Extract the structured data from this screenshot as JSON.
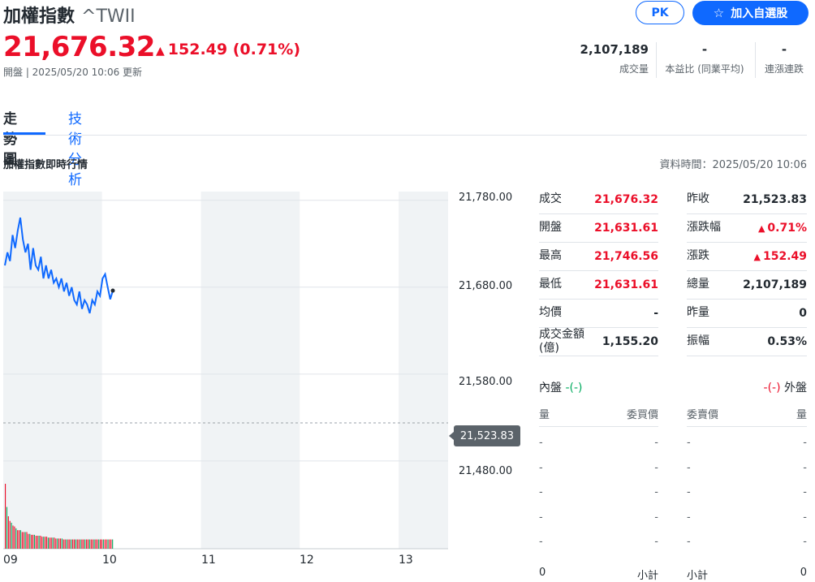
{
  "header": {
    "name": "加權指數",
    "symbol": "^TWII",
    "price": "21,676.32",
    "change_arrow": "▲",
    "change": "152.49 (0.71%)",
    "meta": "開盤 | 2025/05/20 10:06 更新",
    "pk_label": "PK",
    "add_icon": "☆",
    "add_label": "加入自選股"
  },
  "stats": [
    {
      "value": "2,107,189",
      "label": "成交量"
    },
    {
      "value": "-",
      "label": "本益比 (同業平均)"
    },
    {
      "value": "-",
      "label": "連漲連跌"
    }
  ],
  "tabs": [
    "走勢圖",
    "技術分析"
  ],
  "section": {
    "title": "加權指數即時行情",
    "data_time": "資料時間：2025/05/20 10:06"
  },
  "quote": {
    "left": [
      {
        "k": "成交",
        "v": "21,676.32",
        "red": true
      },
      {
        "k": "開盤",
        "v": "21,631.61",
        "red": true
      },
      {
        "k": "最高",
        "v": "21,746.56",
        "red": true
      },
      {
        "k": "最低",
        "v": "21,631.61",
        "red": true
      },
      {
        "k": "均價",
        "v": "-",
        "red": false
      },
      {
        "k": "成交金額\n(億)",
        "v": "1,155.20",
        "red": false
      }
    ],
    "right": [
      {
        "k": "昨收",
        "v": "21,523.83",
        "red": false,
        "arrow": ""
      },
      {
        "k": "漲跌幅",
        "v": "0.71%",
        "red": true,
        "arrow": "▲"
      },
      {
        "k": "漲跌",
        "v": "152.49",
        "red": true,
        "arrow": "▲"
      },
      {
        "k": "總量",
        "v": "2,107,189",
        "red": false,
        "arrow": ""
      },
      {
        "k": "昨量",
        "v": "0",
        "red": false,
        "arrow": ""
      },
      {
        "k": "振幅",
        "v": "0.53%",
        "red": false,
        "arrow": ""
      }
    ]
  },
  "orderbook": {
    "inner_label": "內盤",
    "inner_val": "-(-)",
    "outer_val": "-(-)",
    "outer_label": "外盤",
    "col_qty_left": "量",
    "col_bid": "委買價",
    "col_ask": "委賣價",
    "col_qty_right": "量",
    "dash": "-",
    "sum_left_val": "0",
    "sum_left_label": "小計",
    "sum_right_label": "小計",
    "sum_right_val": "0"
  },
  "chart_data": {
    "type": "line",
    "x_ticks": [
      "09",
      "10",
      "11",
      "12",
      "13"
    ],
    "y_ticks": [
      "21,780.00",
      "21,680.00",
      "21,580.00",
      "21,480.00"
    ],
    "y_values": [
      21780,
      21680,
      21580,
      21480
    ],
    "ylim": [
      21450,
      21790
    ],
    "reference": {
      "label": "21,523.83",
      "value": 21523.83
    },
    "series": [
      {
        "values": [
          21705,
          21720,
          21710,
          21740,
          21725,
          21745,
          21760,
          21735,
          21720,
          21730,
          21700,
          21725,
          21705,
          21700,
          21715,
          21690,
          21705,
          21690,
          21700,
          21685,
          21690,
          21680,
          21690,
          21675,
          21685,
          21670,
          21680,
          21665,
          21660,
          21675,
          21655,
          21665,
          21660,
          21650,
          21665,
          21660,
          21675,
          21670,
          21690,
          21695,
          21680,
          21666,
          21676
        ],
        "color": "#0f69ff"
      }
    ],
    "volume": [
      70,
      45,
      35,
      30,
      28,
      25,
      24,
      22,
      20,
      20,
      20,
      18,
      18,
      18,
      18,
      16,
      16,
      15,
      15,
      15,
      14,
      14,
      14,
      14,
      13,
      13,
      13,
      13,
      12,
      12,
      12,
      12,
      12,
      11,
      11,
      11,
      11,
      11,
      10,
      10,
      10,
      10,
      10,
      10,
      10,
      10,
      10,
      10,
      10,
      10,
      10,
      10,
      10,
      10,
      10,
      10,
      10,
      10,
      10,
      10,
      10,
      10,
      10,
      10,
      10,
      10,
      10,
      10,
      10,
      10,
      10
    ],
    "grid": true
  }
}
